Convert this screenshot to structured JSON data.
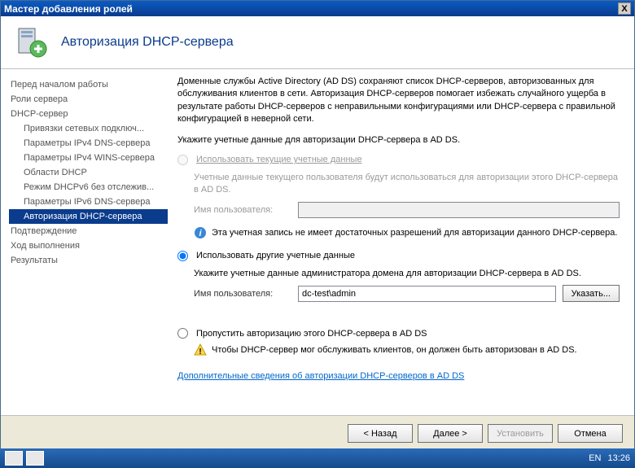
{
  "window": {
    "title": "Мастер добавления ролей",
    "close": "X"
  },
  "header": {
    "title": "Авторизация DHCP-сервера"
  },
  "sidebar": {
    "items": [
      {
        "label": "Перед началом работы"
      },
      {
        "label": "Роли сервера"
      },
      {
        "label": "DHCP-сервер"
      },
      {
        "label": "Привязки сетевых подключ..."
      },
      {
        "label": "Параметры IPv4 DNS-сервера"
      },
      {
        "label": "Параметры IPv4 WINS-сервера"
      },
      {
        "label": "Области DHCP"
      },
      {
        "label": "Режим DHCPv6 без отслежив..."
      },
      {
        "label": "Параметры IPv6 DNS-сервера"
      },
      {
        "label": "Авторизация DHCP-сервера"
      },
      {
        "label": "Подтверждение"
      },
      {
        "label": "Ход выполнения"
      },
      {
        "label": "Результаты"
      }
    ]
  },
  "main": {
    "intro1": "Доменные службы Active Directory (AD DS) сохраняют список DHCP-серверов, авторизованных для обслуживания клиентов в сети. Авторизация DHCP-серверов помогает избежать случайного ущерба в результате работы DHCP-серверов с неправильными конфигурациями или DHCP-сервера с правильной конфигурацией в неверной сети.",
    "intro2": "Укажите учетные данные для авторизации DHCP-сервера в AD DS.",
    "opt1": {
      "label": "Использовать текущие учетные данные",
      "desc": "Учетные данные текущего пользователя будут использоваться для авторизации этого DHCP-сервера в AD DS.",
      "field_label": "Имя пользователя:",
      "value": ""
    },
    "info_msg": "Эта учетная запись не имеет достаточных разрешений для авторизации данного DHCP-сервера.",
    "opt2": {
      "label": "Использовать другие учетные данные",
      "desc": "Укажите учетные данные администратора домена для авторизации DHCP-сервера в AD DS.",
      "field_label": "Имя пользователя:",
      "value": "dc-test\\admin",
      "btn": "Указать..."
    },
    "opt3": {
      "label": "Пропустить авторизацию этого DHCP-сервера в AD DS",
      "warn": "Чтобы DHCP-сервер мог обслуживать клиентов, он должен быть авторизован в AD DS."
    },
    "link": "Дополнительные сведения об авторизации DHCP-серверов в AD DS"
  },
  "buttons": {
    "back": "< Назад",
    "next": "Далее >",
    "install": "Установить",
    "cancel": "Отмена"
  },
  "taskbar": {
    "lang": "EN",
    "time": "13:26"
  }
}
